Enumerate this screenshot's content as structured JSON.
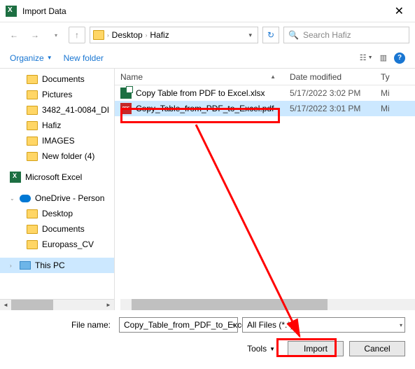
{
  "window": {
    "title": "Import Data"
  },
  "breadcrumb": {
    "part1": "Desktop",
    "part2": "Hafiz"
  },
  "search": {
    "placeholder": "Search Hafiz"
  },
  "toolbar": {
    "organize": "Organize",
    "newfolder": "New folder"
  },
  "tree": {
    "items": [
      {
        "label": "Documents"
      },
      {
        "label": "Pictures"
      },
      {
        "label": "3482_41-0084_DI"
      },
      {
        "label": "Hafiz"
      },
      {
        "label": "IMAGES"
      },
      {
        "label": "New folder (4)"
      }
    ],
    "excel": "Microsoft Excel",
    "onedrive": "OneDrive - Person",
    "od_items": [
      {
        "label": "Desktop"
      },
      {
        "label": "Documents"
      },
      {
        "label": "Europass_CV"
      }
    ],
    "thispc": "This PC"
  },
  "list": {
    "headers": {
      "name": "Name",
      "date": "Date modified",
      "type": "Ty"
    },
    "rows": [
      {
        "name": "Copy Table from PDF to Excel.xlsx",
        "date": "5/17/2022 3:02 PM",
        "type": "Mi",
        "icon": "xlsx"
      },
      {
        "name": "Copy_Table_from_PDF_to_Excel.pdf",
        "date": "5/17/2022 3:01 PM",
        "type": "Mi",
        "icon": "pdf"
      }
    ]
  },
  "bottom": {
    "filename_label": "File name:",
    "filename_value": "Copy_Table_from_PDF_to_Excel.pd",
    "filter": "All Files (*.*)",
    "tools": "Tools",
    "import": "Import",
    "cancel": "Cancel"
  }
}
